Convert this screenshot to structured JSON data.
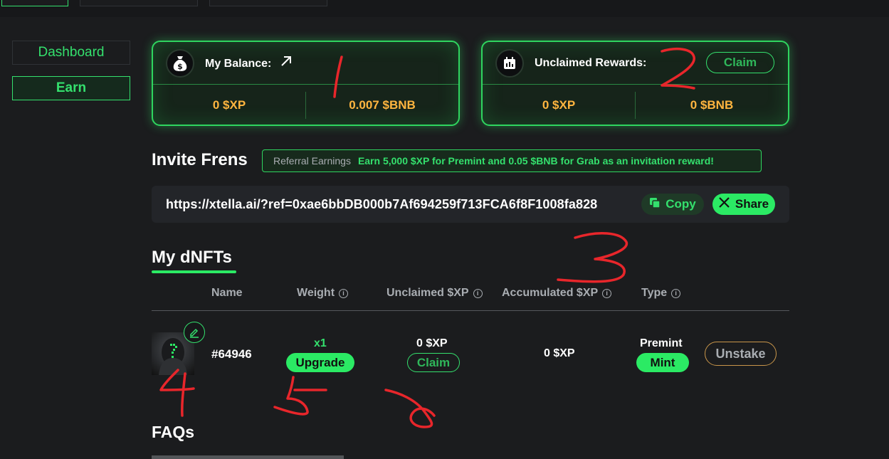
{
  "sidebar": {
    "items": [
      {
        "label": "Dashboard",
        "active": false
      },
      {
        "label": "Earn",
        "active": true
      }
    ]
  },
  "balance_card": {
    "title": "My Balance:",
    "arrow_icon": "arrow-up-right-icon",
    "xp_value": "0 $XP",
    "bnb_value": "0.007 $BNB"
  },
  "rewards_card": {
    "title": "Unclaimed Rewards:",
    "claim_label": "Claim",
    "xp_value": "0 $XP",
    "bnb_value": "0 $BNB"
  },
  "invite": {
    "title": "Invite Frens",
    "banner_label": "Referral Earnings",
    "banner_message": "Earn 5,000 $XP for Premint and 0.05 $BNB for Grab as an invitation reward!",
    "link": "https://xtella.ai/?ref=0xae6bbDB000b7Af694259f713FCA6f8F1008fa828",
    "copy_label": "Copy",
    "share_label": "Share"
  },
  "dnfts": {
    "title": "My dNFTs",
    "headers": {
      "name": "Name",
      "weight": "Weight",
      "unclaimed": "Unclaimed $XP",
      "accumulated": "Accumulated $XP",
      "type": "Type"
    },
    "rows": [
      {
        "id": "#64946",
        "weight": "x1",
        "upgrade_label": "Upgrade",
        "unclaimed": "0 $XP",
        "claim_label": "Claim",
        "accumulated": "0 $XP",
        "type": "Premint",
        "mint_label": "Mint",
        "unstake_label": "Unstake"
      }
    ]
  },
  "faq": {
    "title": "FAQs"
  },
  "annotations": [
    "1",
    "2",
    "3",
    "4",
    "5",
    "6"
  ],
  "colors": {
    "accent": "#2bea64",
    "value_orange": "#ffb53f",
    "background": "#1b1c1e",
    "annotation_red": "#e8262b"
  }
}
